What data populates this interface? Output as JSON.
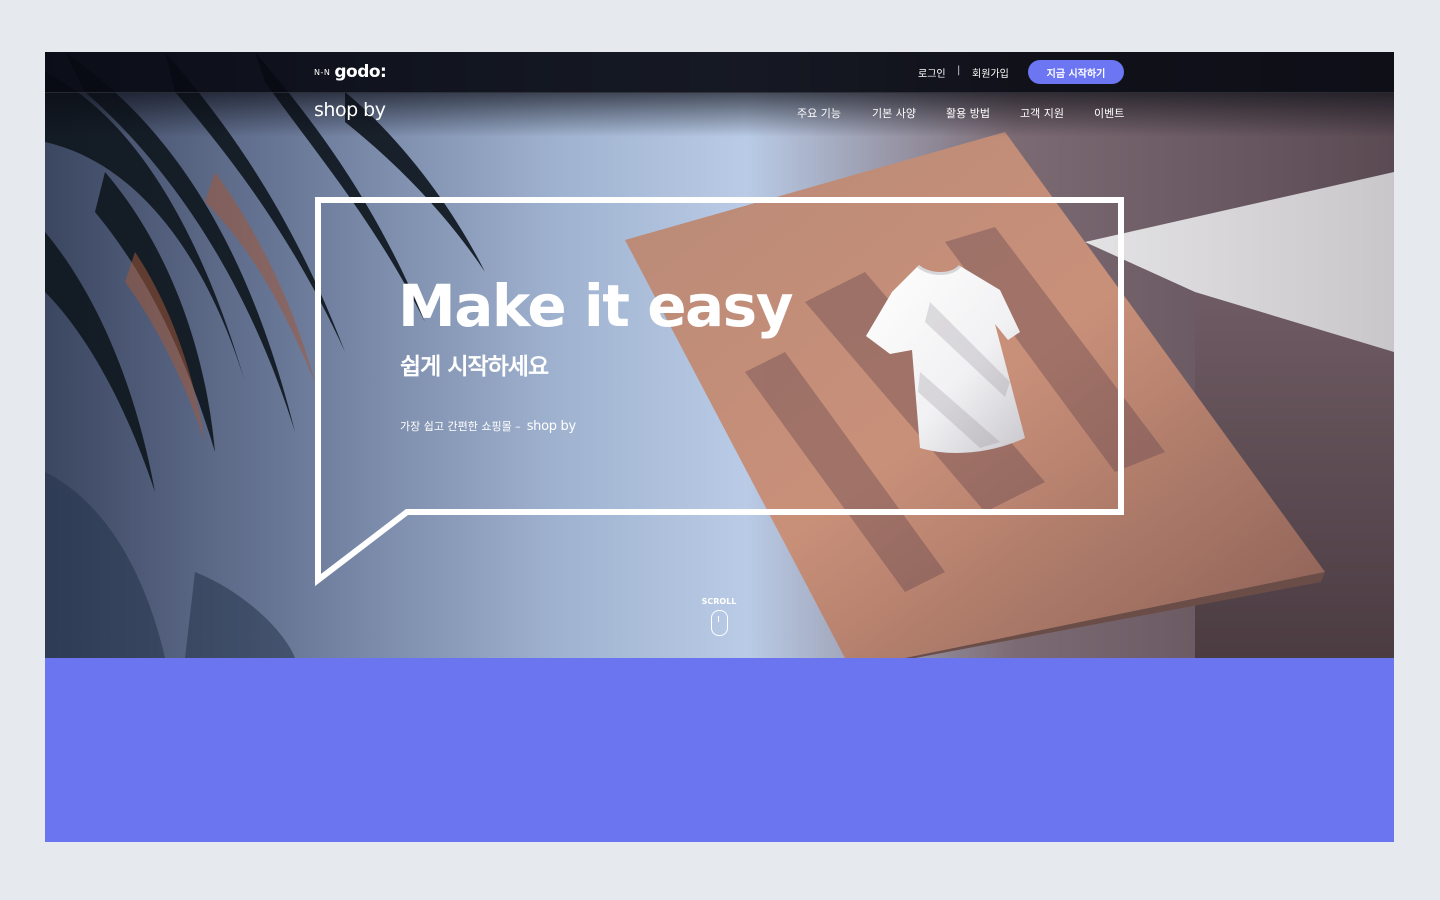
{
  "header": {
    "logo_nhn": "N-N",
    "logo_godo": "godo:",
    "logo_shopby": "shop by",
    "login": "로그인",
    "separator": "|",
    "signup": "회원가입",
    "cta": "지금 시작하기"
  },
  "nav": {
    "items": [
      "주요 기능",
      "기본 사양",
      "활용 방법",
      "고객 지원",
      "이벤트"
    ]
  },
  "hero": {
    "headline": "Make it easy",
    "subheadline": "쉽게 시작하세요",
    "tagline_text": "가장 쉽고 간편한 쇼핑몰 –",
    "tagline_brand": "shop by",
    "scroll_label": "SCROLL"
  },
  "colors": {
    "accent": "#6c76f2",
    "band": "#6b75ef",
    "page_bg": "#e6eaef"
  },
  "icons": [
    "mouse-scroll-icon",
    "tshirt-image"
  ]
}
